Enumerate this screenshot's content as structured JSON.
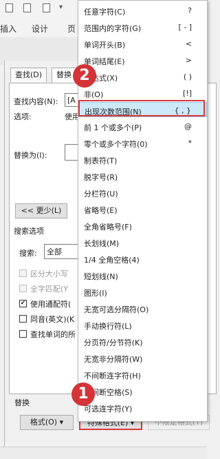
{
  "ribbon": {
    "tab_insert": "插入",
    "tab_design": "设计",
    "tab_page": "页"
  },
  "dialog": {
    "tab_find": "查找(D)",
    "tab_replace": "替换",
    "find_label": "查找内容(N):",
    "find_value": "[A",
    "options_label": "选项:",
    "options_value": "使用",
    "replace_label": "替换为(I):",
    "less_button": "<< 更少(L)",
    "search_options_label": "搜索选项",
    "search_label": "搜索:",
    "search_value": "全部",
    "match_case": "区分大小写",
    "whole_word": "全字匹配(Y",
    "wildcards": "使用通配符(",
    "sounds_like": "同音(英文)(K",
    "all_forms": "查找单词的所",
    "replace_section": "替换",
    "format_button": "格式(O) ▾",
    "special_button": "特殊格式(E) ▾",
    "no_format_button": "不限定格式(T)"
  },
  "menu": {
    "items": [
      {
        "label": "任意字符(C)",
        "key": "?"
      },
      {
        "label": "范围内的字符(G)",
        "key": "[ - ]"
      },
      {
        "label": "单词开头(B)",
        "key": "<"
      },
      {
        "label": "单词结尾(E)",
        "key": ">"
      },
      {
        "label": "表达式(X)",
        "key": "( )"
      },
      {
        "label": "非(O)",
        "key": "[!]"
      },
      {
        "label": "出现次数范围(N)",
        "key": "{ , }"
      },
      {
        "label": "前 1 个或多个(P)",
        "key": "@"
      },
      {
        "label": "零个或多个字符(0)",
        "key": "*"
      },
      {
        "label": "制表符(T)",
        "key": ""
      },
      {
        "label": "脱字号(R)",
        "key": ""
      },
      {
        "label": "分栏符(U)",
        "key": ""
      },
      {
        "label": "省略号(E)",
        "key": ""
      },
      {
        "label": "全角省略号(F)",
        "key": ""
      },
      {
        "label": "长划线(M)",
        "key": ""
      },
      {
        "label": "1/4 全角空格(4)",
        "key": ""
      },
      {
        "label": "短划线(N)",
        "key": ""
      },
      {
        "label": "图形(I)",
        "key": ""
      },
      {
        "label": "无宽可选分隔符(O)",
        "key": ""
      },
      {
        "label": "手动换行符(L)",
        "key": ""
      },
      {
        "label": "分页符/分节符(K)",
        "key": ""
      },
      {
        "label": "无宽非分隔符(W)",
        "key": ""
      },
      {
        "label": "不间断连字符(H)",
        "key": ""
      },
      {
        "label": "不间断空格(S)",
        "key": ""
      },
      {
        "label": "可选连字符(Y)",
        "key": ""
      }
    ]
  },
  "badges": {
    "one": "1",
    "two": "2"
  },
  "colors": {
    "accent_red": "#d43438",
    "highlight": "#cde8f8"
  }
}
